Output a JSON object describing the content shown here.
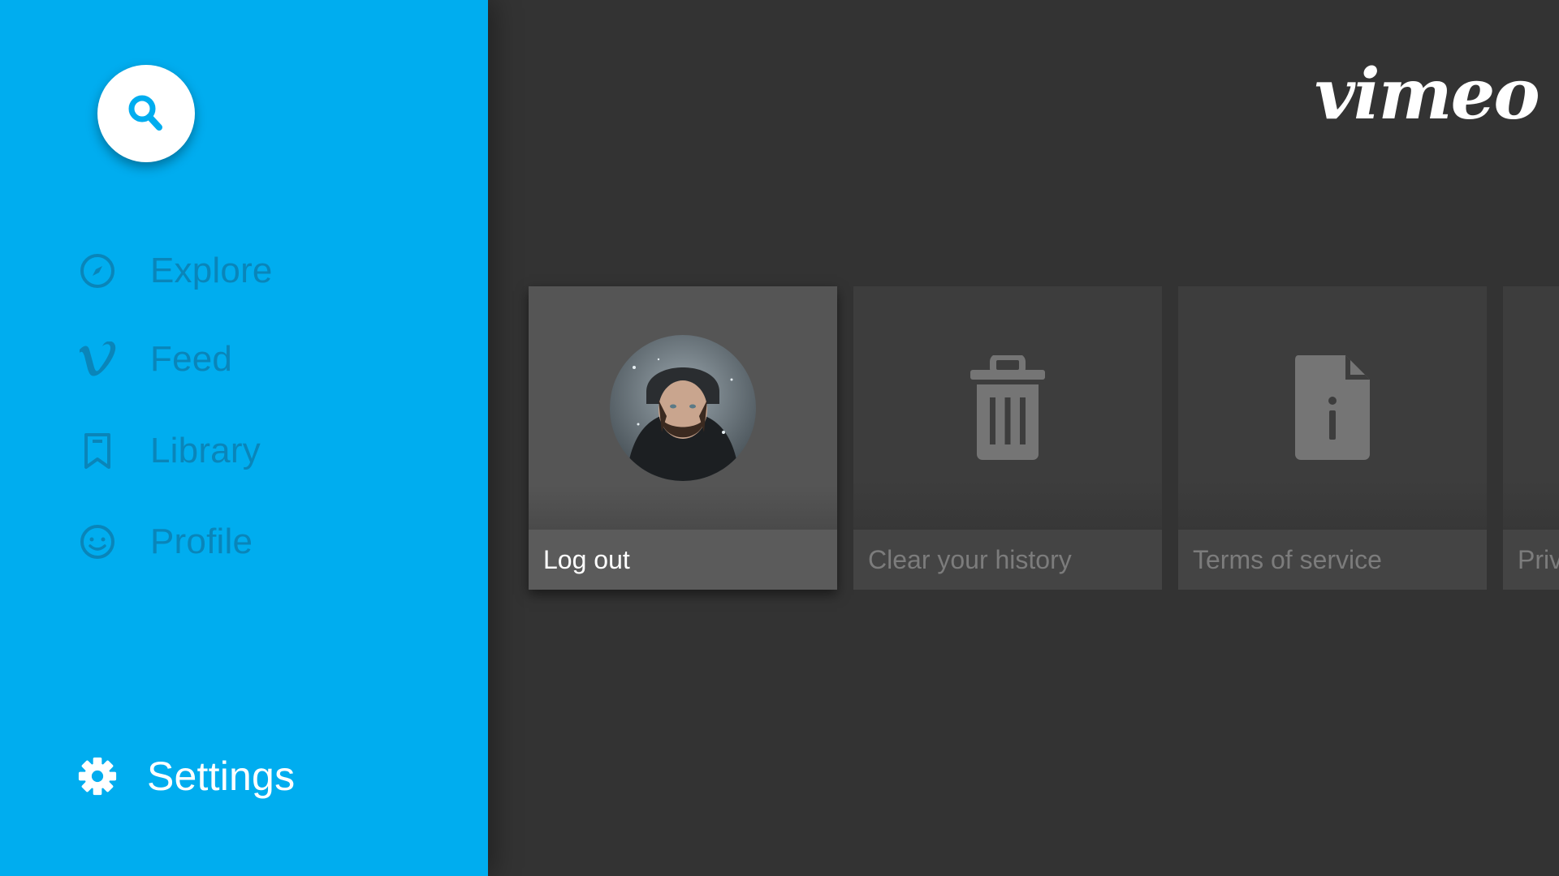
{
  "app": {
    "brand": "vimeo",
    "accent_color": "#00adef",
    "background_color": "#333333"
  },
  "sidebar": {
    "search_icon": "search-icon",
    "items": [
      {
        "label": "Explore",
        "icon": "compass-icon"
      },
      {
        "label": "Feed",
        "icon": "vimeo-v-icon"
      },
      {
        "label": "Library",
        "icon": "bookmark-icon"
      },
      {
        "label": "Profile",
        "icon": "smiley-face-icon"
      }
    ],
    "settings": {
      "label": "Settings",
      "icon": "gear-icon",
      "selected": true
    }
  },
  "settings_cards": [
    {
      "label": "Log out",
      "icon": "user-avatar",
      "focused": true
    },
    {
      "label": "Clear your history",
      "icon": "trash-icon",
      "focused": false
    },
    {
      "label": "Terms of service",
      "icon": "document-info-icon",
      "focused": false
    },
    {
      "label": "Priv",
      "icon": "unknown-icon",
      "focused": false
    }
  ]
}
